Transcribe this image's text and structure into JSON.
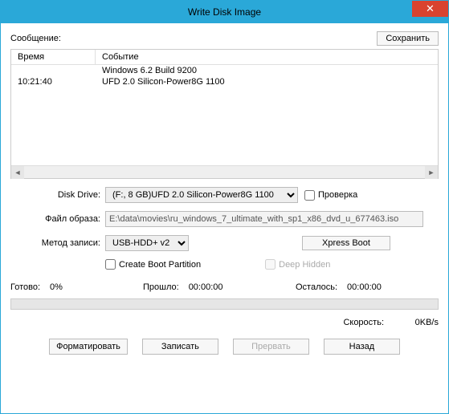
{
  "window": {
    "title": "Write Disk Image"
  },
  "message": {
    "label": "Сообщение:",
    "save_btn": "Сохранить"
  },
  "log": {
    "col_time": "Время",
    "col_event": "Событие",
    "rows": [
      {
        "time": "",
        "event": "Windows 6.2 Build 9200"
      },
      {
        "time": "10:21:40",
        "event": "UFD 2.0 Silicon-Power8G 1100"
      }
    ]
  },
  "drive": {
    "label": "Disk Drive:",
    "value": "(F:, 8 GB)UFD 2.0 Silicon-Power8G 1100",
    "verify_label": "Проверка"
  },
  "image": {
    "label": "Файл образа:",
    "value": "E:\\data\\movies\\ru_windows_7_ultimate_with_sp1_x86_dvd_u_677463.iso"
  },
  "method": {
    "label": "Метод записи:",
    "value": "USB-HDD+ v2",
    "xpress_btn": "Xpress Boot"
  },
  "options": {
    "create_boot": "Create Boot Partition",
    "deep_hidden": "Deep Hidden"
  },
  "status": {
    "ready_label": "Готово:",
    "ready_value": "0%",
    "elapsed_label": "Прошло:",
    "elapsed_value": "00:00:00",
    "remain_label": "Осталось:",
    "remain_value": "00:00:00"
  },
  "speed": {
    "label": "Скорость:",
    "value": "0KB/s"
  },
  "buttons": {
    "format": "Форматировать",
    "write": "Записать",
    "abort": "Прервать",
    "back": "Назад"
  }
}
